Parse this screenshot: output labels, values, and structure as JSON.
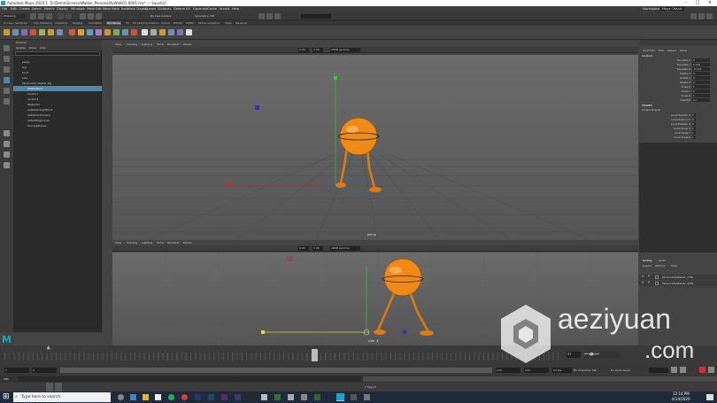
{
  "window": {
    "title": "Autodesk Maya 2020.1: D:\\Demo\\Scenes\\Walker_PersonalityWalk01.0001.ma*  ---  Sausha?"
  },
  "menubar": {
    "items": [
      "File",
      "Edit",
      "Create",
      "Select",
      "Modify",
      "Display",
      "Windows",
      "Mesh",
      "Edit Mesh",
      "Mesh Tools",
      "Mesh Display",
      "Curves",
      "Surfaces",
      "Deform",
      "UV",
      "Generate",
      "Cache",
      "Arnold",
      "Help"
    ],
    "workspace": "Workspace :",
    "workspace_value": "Maya Classic"
  },
  "statusline": {
    "mode": "Modeling",
    "no_live": "No Live Surface",
    "symmetry": "Symmetry: Off"
  },
  "shelf": {
    "tabs": [
      "Curves / Surfaces",
      "Poly Modeling",
      "Sculpting",
      "Rigging",
      "Animation",
      "Rendering",
      "FX",
      "FX Caching",
      "Custom",
      "Arnold",
      "Bifrost",
      "MASH",
      "Motion Graphics",
      "XGen",
      "Personal"
    ]
  },
  "outliner": {
    "title": "Outliner",
    "menu": [
      "Display",
      "Show",
      "Help"
    ],
    "items": [
      "persp",
      "top",
      "front",
      "side",
      "Personality Walker Rig",
      "WalkerRoot",
      "locator1",
      "locator2",
      "Walker01",
      "aaWalkerLightRoot",
      "aaWalkerCamera",
      "defaultRigGroup",
      "trianglePlanes"
    ],
    "selected_index": 5
  },
  "viewport_top": {
    "menu": [
      "View",
      "Shading",
      "Lighting",
      "Show",
      "Renderer",
      "Panels"
    ],
    "camera": "persp",
    "fields": [
      "0.00",
      "1.00"
    ],
    "color_space": "sRGB gamma"
  },
  "viewport_bottom": {
    "menu": [
      "View",
      "Shading",
      "Lighting",
      "Show",
      "Renderer",
      "Panels"
    ],
    "camera": "side -X",
    "fields": [
      "0.00",
      "1.00"
    ],
    "color_space": "sRGB gamma"
  },
  "channelbox": {
    "tabs": [
      "Channels",
      "Edit",
      "Object",
      "Show"
    ],
    "object": "locator1",
    "attributes": [
      {
        "name": "Translate X",
        "value": "0"
      },
      {
        "name": "Translate Y",
        "value": "0.149"
      },
      {
        "name": "Translate Z",
        "value": "-0.144"
      },
      {
        "name": "Rotate X",
        "value": "0"
      },
      {
        "name": "Rotate Y",
        "value": "0"
      },
      {
        "name": "Rotate Z",
        "value": "0"
      },
      {
        "name": "Scale X",
        "value": "1"
      },
      {
        "name": "Scale Y",
        "value": "1"
      },
      {
        "name": "Scale Z",
        "value": "1"
      },
      {
        "name": "Visibility",
        "value": "on"
      }
    ],
    "shapes_label": "SHAPES",
    "shape_name": "locatorShape1",
    "local_attrs": [
      {
        "name": "Local Position X",
        "value": "0"
      },
      {
        "name": "Local Position Y",
        "value": "0"
      },
      {
        "name": "Local Position Z",
        "value": "0"
      },
      {
        "name": "Local Scale X",
        "value": "1"
      },
      {
        "name": "Local Scale Y",
        "value": "1"
      },
      {
        "name": "Local Scale Z",
        "value": "1"
      }
    ]
  },
  "layers": {
    "tabs": [
      "Display",
      "Anim"
    ],
    "menu": [
      "Layers",
      "Options",
      "Help"
    ],
    "rows": [
      "PersonalityWalker_CTRL",
      "PersonalityWalker_SKEL"
    ]
  },
  "timeline": {
    "current_frame": "55",
    "start": "1",
    "end": "120",
    "range_start": "1",
    "range_end": "120",
    "fps": "24 fps",
    "no_char": "No Character Set",
    "no_anim": "No Anim Layer"
  },
  "cmdline": {
    "lang": "MEL"
  },
  "helpline": {
    "text": "1 fixed 0"
  },
  "taskbar": {
    "search": "Type here to search",
    "time": "12:14 PM",
    "date": "4/14/2020"
  },
  "watermark": {
    "text1": "aeziyuan",
    ".com": ".com"
  },
  "colors": {
    "accent": "#5285a6",
    "ball": "#f08a17"
  }
}
